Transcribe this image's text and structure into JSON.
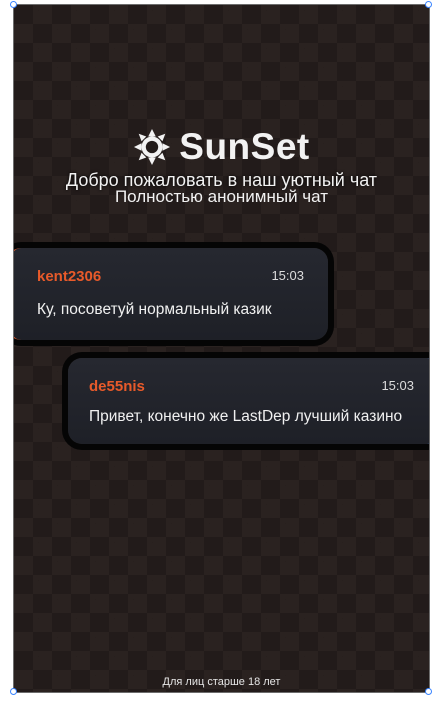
{
  "header": {
    "logo_text": "SunSet",
    "welcome": "Добро пожаловать в наш уютный чат",
    "subtitle": "Полностью анонимный чат"
  },
  "messages": [
    {
      "author": "kent2306",
      "time": "15:03",
      "text": "Ку, посоветуй нормальный казик",
      "side": "left"
    },
    {
      "author": "de55nis",
      "time": "15:03",
      "text": "Привет, конечно же LastDep лучший казино",
      "side": "right"
    }
  ],
  "footer": {
    "age_notice": "Для лиц старше 18 лет"
  },
  "colors": {
    "background": "#221b1a",
    "author": "#e85a2a",
    "left_accent": "#e2582b",
    "right_accent": "#3a74c4",
    "bubble": "#22242b"
  },
  "icons": {
    "logo": "sun-icon"
  }
}
